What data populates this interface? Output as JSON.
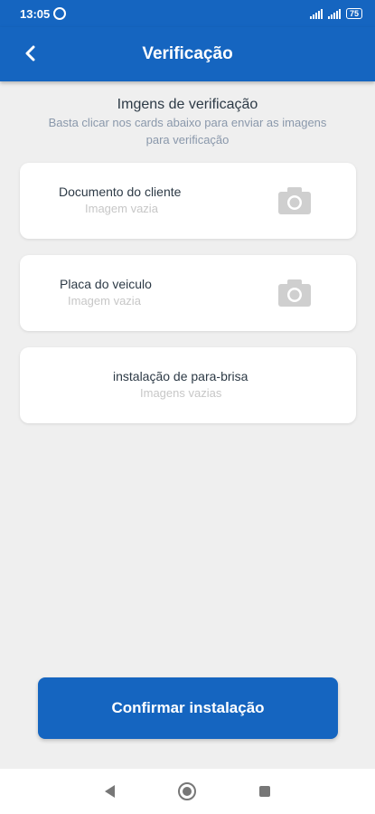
{
  "statusbar": {
    "time": "13:05",
    "battery": "75"
  },
  "appbar": {
    "title": "Verificação",
    "back_icon": "chevron-left-icon"
  },
  "intro": {
    "heading": "Imgens de verificação",
    "subheading": "Basta clicar nos cards abaixo para enviar as imagens para verificação"
  },
  "cards": [
    {
      "label": "Documento do cliente",
      "status": "Imagem vazia",
      "icon": "camera-icon"
    },
    {
      "label": "Placa do veiculo",
      "status": "Imagem vazia",
      "icon": "camera-icon"
    },
    {
      "label": "instalação de para-brisa",
      "status": "Imagens vazias"
    }
  ],
  "confirm_button": {
    "label": "Confirmar instalação"
  },
  "colors": {
    "primary": "#1565c0",
    "background": "#efefef",
    "card": "#ffffff"
  }
}
